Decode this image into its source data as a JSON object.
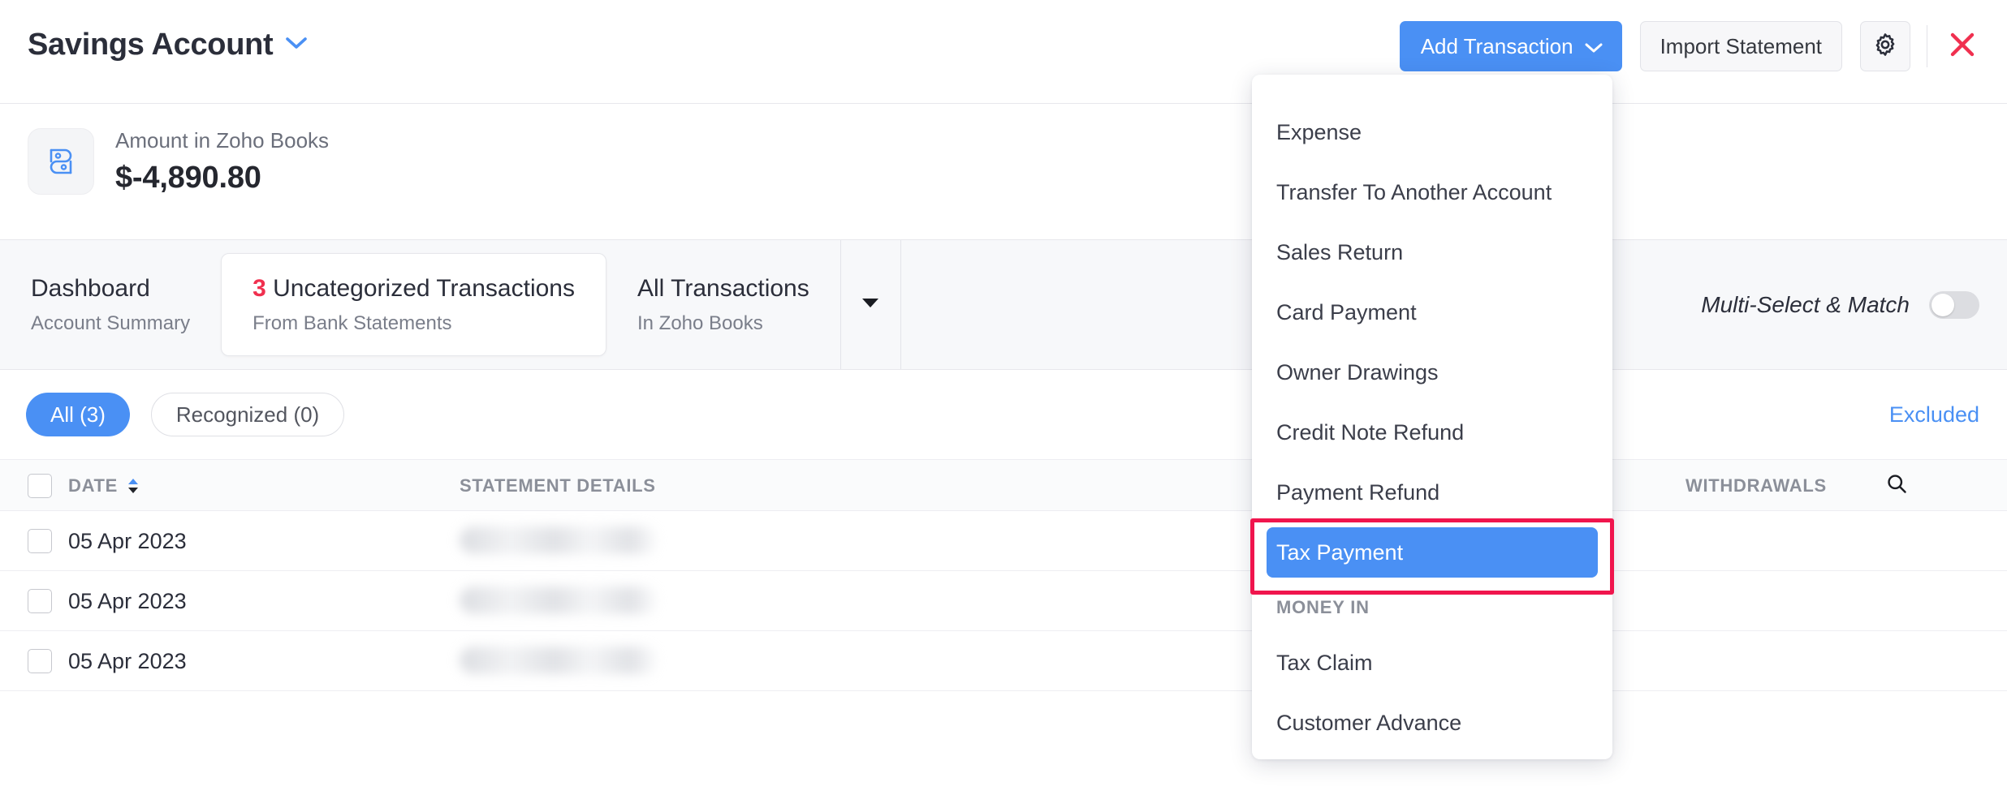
{
  "header": {
    "title": "Savings Account",
    "title_caret_icon": "chevron-down-icon",
    "add_transaction_label": "Add Transaction",
    "add_transaction_caret_icon": "chevron-down-icon",
    "import_statement_label": "Import Statement",
    "settings_icon": "gear-icon",
    "close_icon": "close-x-icon",
    "accent_blue": "#4a90f4",
    "close_red": "#f0304f"
  },
  "amount": {
    "icon": "zoho-books-logo-icon",
    "label": "Amount in Zoho Books",
    "value": "$-4,890.80"
  },
  "tabs": [
    {
      "main": "Dashboard",
      "sub": "Account Summary",
      "active": false,
      "count": ""
    },
    {
      "main": "Uncategorized Transactions",
      "sub": "From Bank Statements",
      "active": true,
      "count": "3"
    },
    {
      "main": "All Transactions",
      "sub": "In Zoho Books",
      "active": false,
      "count": ""
    }
  ],
  "multi_select": {
    "label": "Multi-Select & Match",
    "state": "off"
  },
  "filters": {
    "pills": [
      {
        "label": "All (3)",
        "active": true
      },
      {
        "label": "Recognized (0)",
        "active": false
      }
    ],
    "excluded_label": "Excluded"
  },
  "table": {
    "columns": {
      "date": "DATE",
      "statement_details": "STATEMENT DETAILS",
      "withdrawals": "WITHDRAWALS"
    },
    "sort_icon": "sort-asc-desc-icon",
    "search_icon": "search-icon",
    "rows": [
      {
        "date": "05 Apr 2023",
        "details": "",
        "withdrawals": ""
      },
      {
        "date": "05 Apr 2023",
        "details": "",
        "withdrawals": ""
      },
      {
        "date": "05 Apr 2023",
        "details": "",
        "withdrawals": ""
      }
    ]
  },
  "menu": {
    "items": [
      {
        "label": "Expense",
        "type": "item",
        "selected": false
      },
      {
        "label": "Transfer To Another Account",
        "type": "item",
        "selected": false
      },
      {
        "label": "Sales Return",
        "type": "item",
        "selected": false
      },
      {
        "label": "Card Payment",
        "type": "item",
        "selected": false
      },
      {
        "label": "Owner Drawings",
        "type": "item",
        "selected": false
      },
      {
        "label": "Credit Note Refund",
        "type": "item",
        "selected": false
      },
      {
        "label": "Payment Refund",
        "type": "item",
        "selected": false
      },
      {
        "label": "Tax Payment",
        "type": "item",
        "selected": true
      },
      {
        "label": "MONEY IN",
        "type": "group",
        "selected": false
      },
      {
        "label": "Tax Claim",
        "type": "item",
        "selected": false
      },
      {
        "label": "Customer Advance",
        "type": "item",
        "selected": false
      }
    ],
    "highlight_color": "#4a90f4",
    "annotation_color": "#f0154d"
  }
}
